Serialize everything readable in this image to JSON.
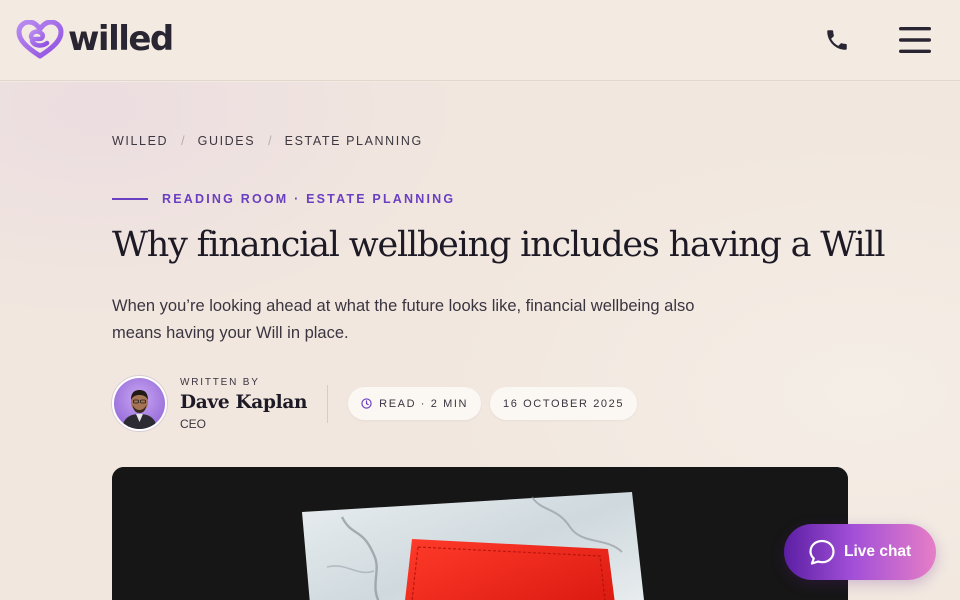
{
  "header": {
    "logo_text": "willed",
    "logo_icon": "heart-e-icon",
    "phone_icon": "phone-icon",
    "menu_icon": "hamburger-menu-icon"
  },
  "breadcrumb": [
    "WILLED",
    "GUIDES",
    "ESTATE PLANNING"
  ],
  "breadcrumb_separator": "/",
  "article": {
    "eyebrow": "READING ROOM · ESTATE PLANNING",
    "title": "Why financial wellbeing includes having a Will",
    "lede": "When you’re looking ahead at what the future looks like, financial wellbeing also means having your Will in place."
  },
  "author": {
    "kicker": "WRITTEN BY",
    "name": "Dave Kaplan",
    "role": "CEO"
  },
  "meta": {
    "read_time": "READ · 2 MIN",
    "read_icon": "clock-icon",
    "date": "16 OCTOBER 2025"
  },
  "live_chat": {
    "label": "Live chat",
    "icon": "chat-bubble-icon"
  },
  "colors": {
    "brand_purple": "#6a3fc1",
    "background": "#f3ebe2",
    "text_dark": "#1d1a26",
    "chat_gradient_start": "#5b1fa3",
    "chat_gradient_end": "#e67ec6"
  }
}
